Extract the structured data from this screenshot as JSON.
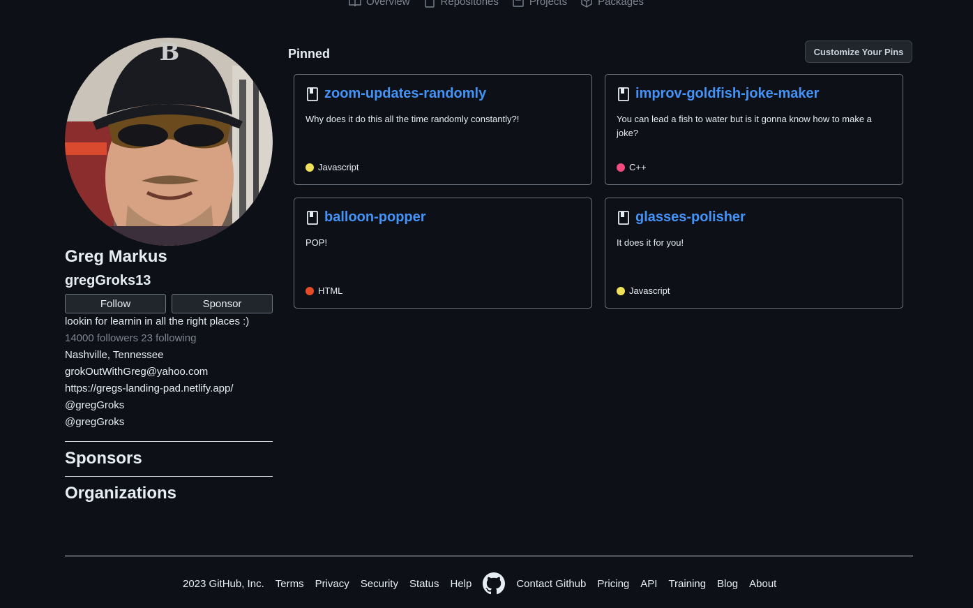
{
  "nav": {
    "tabs": [
      {
        "label": "Overview",
        "icon": "book-icon"
      },
      {
        "label": "Repositories",
        "icon": "repo-icon"
      },
      {
        "label": "Projects",
        "icon": "project-icon"
      },
      {
        "label": "Packages",
        "icon": "package-icon"
      }
    ]
  },
  "profile": {
    "avatar_icon": "avatar-photo",
    "name": "Greg Markus",
    "login": "gregGroks13",
    "follow_label": "Follow",
    "sponsor_label": "Sponsor",
    "bio": "lookin for learnin in all the right places :)",
    "followers_text": "14000 followers 23 following",
    "location": "Nashville, Tennessee",
    "email": "grokOutWithGreg@yahoo.com",
    "website": "https://gregs-landing-pad.netlify.app/",
    "social_1": "@gregGroks",
    "social_2": "@gregGroks",
    "sponsors_heading": "Sponsors",
    "organizations_heading": "Organizations"
  },
  "pinned": {
    "heading": "Pinned",
    "customize_label": "Customize Your Pins",
    "repos": [
      {
        "title": "zoom-updates-randomly",
        "description": "Why does it do this all the time randomly constantly?!",
        "language": "Javascript",
        "language_color": "#f1e05a"
      },
      {
        "title": "improv-goldfish-joke-maker",
        "description": "You can lead a fish to water but is it gonna know how to make a joke?",
        "language": "C++",
        "language_color": "#f34b7d"
      },
      {
        "title": "balloon-popper",
        "description": "POP!",
        "language": "HTML",
        "language_color": "#e34c26"
      },
      {
        "title": "glasses-polisher",
        "description": "It does it for you!",
        "language": "Javascript",
        "language_color": "#f1e05a"
      }
    ]
  },
  "footer": {
    "copyright": "2023 GitHub, Inc.",
    "links_left": [
      "Terms",
      "Privacy",
      "Security",
      "Status",
      "Help"
    ],
    "logo_icon": "github-logo-icon",
    "links_right": [
      "Contact Github",
      "Pricing",
      "API",
      "Training",
      "Blog",
      "About"
    ]
  }
}
